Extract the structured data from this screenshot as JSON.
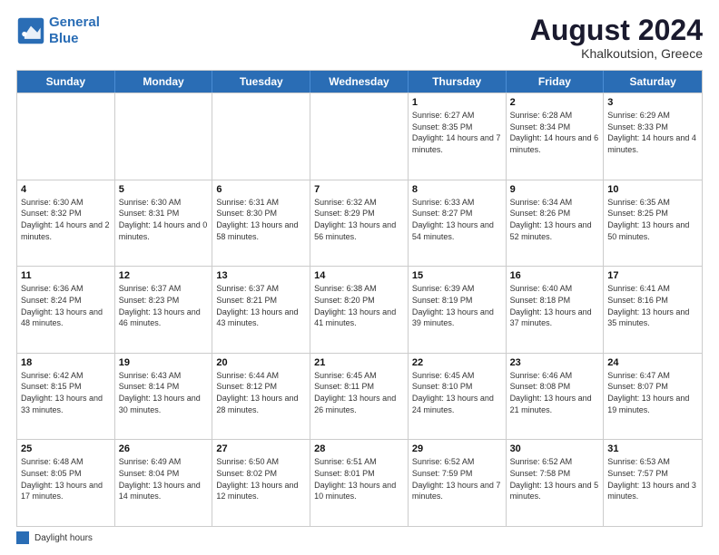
{
  "logo": {
    "line1": "General",
    "line2": "Blue"
  },
  "title": "August 2024",
  "subtitle": "Khalkoutsion, Greece",
  "days_of_week": [
    "Sunday",
    "Monday",
    "Tuesday",
    "Wednesday",
    "Thursday",
    "Friday",
    "Saturday"
  ],
  "note_label": "Daylight hours",
  "weeks": [
    [
      {
        "day": "",
        "info": ""
      },
      {
        "day": "",
        "info": ""
      },
      {
        "day": "",
        "info": ""
      },
      {
        "day": "",
        "info": ""
      },
      {
        "day": "1",
        "info": "Sunrise: 6:27 AM\nSunset: 8:35 PM\nDaylight: 14 hours\nand 7 minutes."
      },
      {
        "day": "2",
        "info": "Sunrise: 6:28 AM\nSunset: 8:34 PM\nDaylight: 14 hours\nand 6 minutes."
      },
      {
        "day": "3",
        "info": "Sunrise: 6:29 AM\nSunset: 8:33 PM\nDaylight: 14 hours\nand 4 minutes."
      }
    ],
    [
      {
        "day": "4",
        "info": "Sunrise: 6:30 AM\nSunset: 8:32 PM\nDaylight: 14 hours\nand 2 minutes."
      },
      {
        "day": "5",
        "info": "Sunrise: 6:30 AM\nSunset: 8:31 PM\nDaylight: 14 hours\nand 0 minutes."
      },
      {
        "day": "6",
        "info": "Sunrise: 6:31 AM\nSunset: 8:30 PM\nDaylight: 13 hours\nand 58 minutes."
      },
      {
        "day": "7",
        "info": "Sunrise: 6:32 AM\nSunset: 8:29 PM\nDaylight: 13 hours\nand 56 minutes."
      },
      {
        "day": "8",
        "info": "Sunrise: 6:33 AM\nSunset: 8:27 PM\nDaylight: 13 hours\nand 54 minutes."
      },
      {
        "day": "9",
        "info": "Sunrise: 6:34 AM\nSunset: 8:26 PM\nDaylight: 13 hours\nand 52 minutes."
      },
      {
        "day": "10",
        "info": "Sunrise: 6:35 AM\nSunset: 8:25 PM\nDaylight: 13 hours\nand 50 minutes."
      }
    ],
    [
      {
        "day": "11",
        "info": "Sunrise: 6:36 AM\nSunset: 8:24 PM\nDaylight: 13 hours\nand 48 minutes."
      },
      {
        "day": "12",
        "info": "Sunrise: 6:37 AM\nSunset: 8:23 PM\nDaylight: 13 hours\nand 46 minutes."
      },
      {
        "day": "13",
        "info": "Sunrise: 6:37 AM\nSunset: 8:21 PM\nDaylight: 13 hours\nand 43 minutes."
      },
      {
        "day": "14",
        "info": "Sunrise: 6:38 AM\nSunset: 8:20 PM\nDaylight: 13 hours\nand 41 minutes."
      },
      {
        "day": "15",
        "info": "Sunrise: 6:39 AM\nSunset: 8:19 PM\nDaylight: 13 hours\nand 39 minutes."
      },
      {
        "day": "16",
        "info": "Sunrise: 6:40 AM\nSunset: 8:18 PM\nDaylight: 13 hours\nand 37 minutes."
      },
      {
        "day": "17",
        "info": "Sunrise: 6:41 AM\nSunset: 8:16 PM\nDaylight: 13 hours\nand 35 minutes."
      }
    ],
    [
      {
        "day": "18",
        "info": "Sunrise: 6:42 AM\nSunset: 8:15 PM\nDaylight: 13 hours\nand 33 minutes."
      },
      {
        "day": "19",
        "info": "Sunrise: 6:43 AM\nSunset: 8:14 PM\nDaylight: 13 hours\nand 30 minutes."
      },
      {
        "day": "20",
        "info": "Sunrise: 6:44 AM\nSunset: 8:12 PM\nDaylight: 13 hours\nand 28 minutes."
      },
      {
        "day": "21",
        "info": "Sunrise: 6:45 AM\nSunset: 8:11 PM\nDaylight: 13 hours\nand 26 minutes."
      },
      {
        "day": "22",
        "info": "Sunrise: 6:45 AM\nSunset: 8:10 PM\nDaylight: 13 hours\nand 24 minutes."
      },
      {
        "day": "23",
        "info": "Sunrise: 6:46 AM\nSunset: 8:08 PM\nDaylight: 13 hours\nand 21 minutes."
      },
      {
        "day": "24",
        "info": "Sunrise: 6:47 AM\nSunset: 8:07 PM\nDaylight: 13 hours\nand 19 minutes."
      }
    ],
    [
      {
        "day": "25",
        "info": "Sunrise: 6:48 AM\nSunset: 8:05 PM\nDaylight: 13 hours\nand 17 minutes."
      },
      {
        "day": "26",
        "info": "Sunrise: 6:49 AM\nSunset: 8:04 PM\nDaylight: 13 hours\nand 14 minutes."
      },
      {
        "day": "27",
        "info": "Sunrise: 6:50 AM\nSunset: 8:02 PM\nDaylight: 13 hours\nand 12 minutes."
      },
      {
        "day": "28",
        "info": "Sunrise: 6:51 AM\nSunset: 8:01 PM\nDaylight: 13 hours\nand 10 minutes."
      },
      {
        "day": "29",
        "info": "Sunrise: 6:52 AM\nSunset: 7:59 PM\nDaylight: 13 hours\nand 7 minutes."
      },
      {
        "day": "30",
        "info": "Sunrise: 6:52 AM\nSunset: 7:58 PM\nDaylight: 13 hours\nand 5 minutes."
      },
      {
        "day": "31",
        "info": "Sunrise: 6:53 AM\nSunset: 7:57 PM\nDaylight: 13 hours\nand 3 minutes."
      }
    ]
  ]
}
